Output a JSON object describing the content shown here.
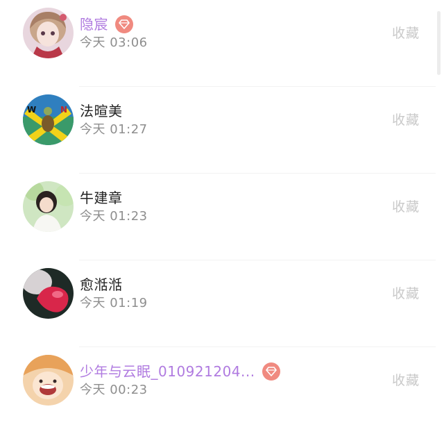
{
  "conversations": [
    {
      "name": "隐宸",
      "time": "今天 03:06",
      "vip": true,
      "action": "收藏",
      "badge_icon": "diamond-icon"
    },
    {
      "name": "法暄美",
      "time": "今天 01:27",
      "vip": false,
      "action": "收藏"
    },
    {
      "name": "牛建章",
      "time": "今天 01:23",
      "vip": false,
      "action": "收藏"
    },
    {
      "name": "愈湉湉",
      "time": "今天 01:19",
      "vip": false,
      "action": "收藏"
    },
    {
      "name": "少年与云眠_010921204...",
      "time": "今天 00:23",
      "vip": true,
      "action": "收藏",
      "badge_icon": "diamond-icon"
    }
  ],
  "colors": {
    "vip_name": "#b07be0",
    "normal_name": "#222222",
    "time": "#8e8e8e",
    "action": "#c9c9c9",
    "badge": "#f08a80"
  }
}
